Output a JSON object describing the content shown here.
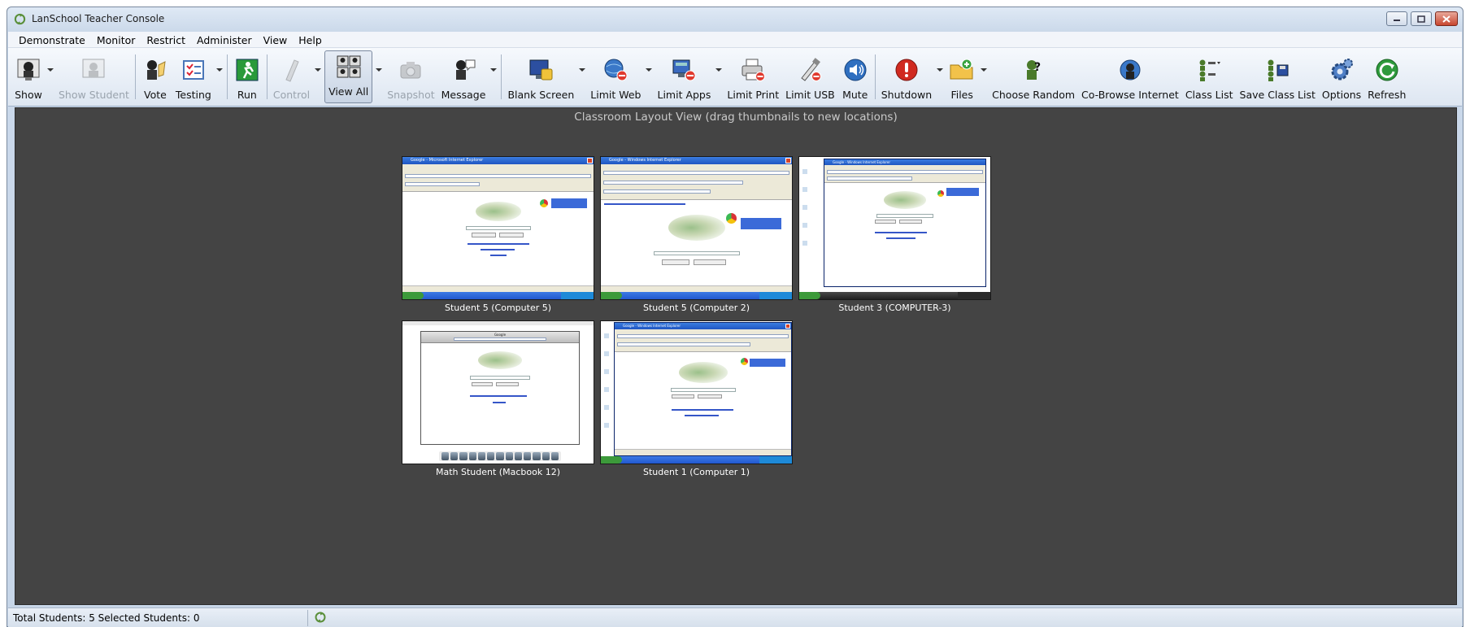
{
  "window": {
    "title": "LanSchool Teacher Console",
    "app_icon": "lanschool-refresh-icon"
  },
  "menu": [
    {
      "label": "Demonstrate"
    },
    {
      "label": "Monitor"
    },
    {
      "label": "Restrict"
    },
    {
      "label": "Administer"
    },
    {
      "label": "View"
    },
    {
      "label": "Help"
    }
  ],
  "toolbar": {
    "show": "Show",
    "show_student": "Show Student",
    "vote": "Vote",
    "testing": "Testing",
    "run": "Run",
    "control": "Control",
    "view_all": "View All",
    "snapshot": "Snapshot",
    "message": "Message",
    "blank_screen": "Blank Screen",
    "limit_web": "Limit Web",
    "limit_apps": "Limit Apps",
    "limit_print": "Limit Print",
    "limit_usb": "Limit USB",
    "mute": "Mute",
    "shutdown": "Shutdown",
    "files": "Files",
    "choose_random": "Choose Random",
    "co_browse": "Co-Browse Internet",
    "class_list": "Class List",
    "save_class_list": "Save Class List",
    "options": "Options",
    "refresh": "Refresh"
  },
  "canvas": {
    "title": "Classroom Layout View (drag thumbnails to new locations)",
    "thumbnails": [
      {
        "caption": "Student 5 (Computer 5)",
        "window_title": "Google - Microsoft Internet Explorer"
      },
      {
        "caption": "Student 5 (Computer 2)",
        "window_title": "Google - Windows Internet Explorer"
      },
      {
        "caption": "Student 3 (COMPUTER-3)",
        "window_title": "Google - Windows Internet Explorer"
      },
      {
        "caption": "Math Student (Macbook 12)",
        "window_title": "Google"
      },
      {
        "caption": "Student 1 (Computer 1)",
        "window_title": "Google - Windows Internet Explorer"
      }
    ]
  },
  "statusbar": {
    "text": "Total Students: 5  Selected Students: 0"
  },
  "colors": {
    "canvas_bg": "#444444",
    "caption_text": "#ffffff",
    "toolbar_bg": "#e6ecf5"
  }
}
